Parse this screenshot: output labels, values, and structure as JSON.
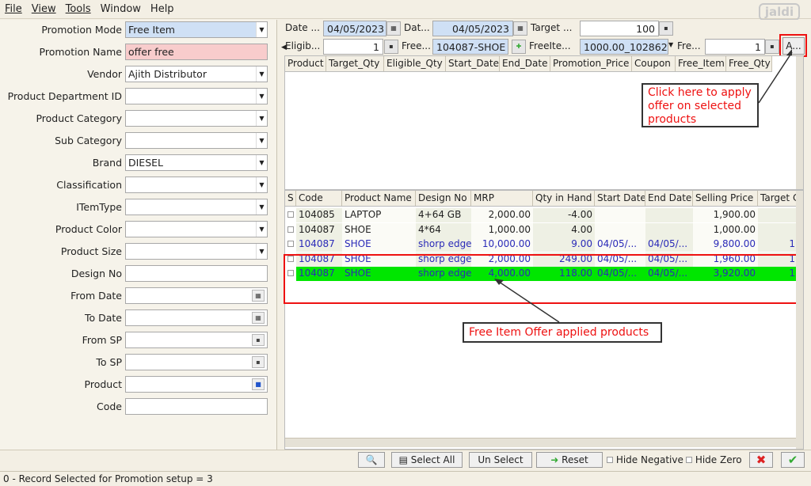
{
  "menu": [
    "File",
    "View",
    "Tools",
    "Window",
    "Help"
  ],
  "logo": "jaldi",
  "left_form": [
    {
      "label": "Promotion Mode",
      "value": "Free Item",
      "kind": "dropdown",
      "style": "blue"
    },
    {
      "label": "Promotion Name",
      "value": "offer free",
      "kind": "text",
      "style": "pink"
    },
    {
      "label": "Vendor",
      "value": "Ajith Distributor",
      "kind": "dropdown",
      "style": ""
    },
    {
      "label": "Product Department ID",
      "value": "",
      "kind": "dropdown",
      "style": ""
    },
    {
      "label": "Product Category",
      "value": "",
      "kind": "dropdown",
      "style": ""
    },
    {
      "label": "Sub Category",
      "value": "",
      "kind": "dropdown",
      "style": ""
    },
    {
      "label": "Brand",
      "value": "DIESEL",
      "kind": "dropdown",
      "style": ""
    },
    {
      "label": "Classification",
      "value": "",
      "kind": "dropdown",
      "style": ""
    },
    {
      "label": "ITemType",
      "value": "",
      "kind": "dropdown",
      "style": ""
    },
    {
      "label": "Product Color",
      "value": "",
      "kind": "dropdown",
      "style": ""
    },
    {
      "label": "Product Size",
      "value": "",
      "kind": "dropdown",
      "style": ""
    },
    {
      "label": "Design No",
      "value": "",
      "kind": "text",
      "style": ""
    },
    {
      "label": "From Date",
      "value": "",
      "kind": "date",
      "style": ""
    },
    {
      "label": "To Date",
      "value": "",
      "kind": "date",
      "style": ""
    },
    {
      "label": "From SP",
      "value": "",
      "kind": "num",
      "style": ""
    },
    {
      "label": "To SP",
      "value": "",
      "kind": "num",
      "style": ""
    },
    {
      "label": "Product",
      "value": "",
      "kind": "lookup",
      "style": ""
    },
    {
      "label": "Code",
      "value": "",
      "kind": "text",
      "style": ""
    }
  ],
  "top_form": {
    "date_from_label": "Date ...",
    "date_from_value": "04/05/2023",
    "date_to_label": "Dat...",
    "date_to_value": "04/05/2023",
    "target_label": "Target ...",
    "target_value": "100",
    "eligible_label": "Eligib...",
    "eligible_value": "1",
    "free_label": "Free...",
    "free_value": "104087-SHOE",
    "free_item_label": "FreeIte...",
    "free_item_value": "1000.00_102862",
    "free_qty_label": "Fre...",
    "free_qty_value": "1",
    "apply_label": "A..."
  },
  "promo_grid_columns": [
    "Product",
    "Target_Qty",
    "Eligible_Qty",
    "Start_Date",
    "End_Date",
    "Promotion_Price",
    "Coupon",
    "Free_Item",
    "Free_Qty"
  ],
  "product_grid_columns": [
    "S",
    "Code",
    "Product Name",
    "Design No",
    "MRP",
    "Qty in Hand",
    "Start Date",
    "End Date",
    "Selling Price",
    "Target C"
  ],
  "product_rows": [
    {
      "code": "104085",
      "name": "LAPTOP",
      "design": "4+64 GB",
      "mrp": "2,000.00",
      "qty": "-4.00",
      "start": "",
      "end": "",
      "sp": "1,900.00",
      "target": "",
      "state": "normal"
    },
    {
      "code": "104087",
      "name": "SHOE",
      "design": "4*64",
      "mrp": "1,000.00",
      "qty": "4.00",
      "start": "",
      "end": "",
      "sp": "1,000.00",
      "target": "",
      "state": "normal"
    },
    {
      "code": "104087",
      "name": "SHOE",
      "design": "shorp edge",
      "mrp": "10,000.00",
      "qty": "9.00",
      "start": "04/05/...",
      "end": "04/05/...",
      "sp": "9,800.00",
      "target": "1",
      "state": "applied"
    },
    {
      "code": "104087",
      "name": "SHOE",
      "design": "shorp edge",
      "mrp": "2,000.00",
      "qty": "249.00",
      "start": "04/05/...",
      "end": "04/05/...",
      "sp": "1,960.00",
      "target": "1",
      "state": "applied"
    },
    {
      "code": "104087",
      "name": "SHOE",
      "design": "shorp edge",
      "mrp": "4,000.00",
      "qty": "118.00",
      "start": "04/05/...",
      "end": "04/05/...",
      "sp": "3,920.00",
      "target": "1",
      "state": "selected"
    }
  ],
  "bottom": {
    "select_all": "Select All",
    "un_select": "Un Select",
    "reset": "Reset",
    "hide_negative": "Hide Negative",
    "hide_zero": "Hide Zero"
  },
  "status": "0 - Record Selected for Promotion setup = 3",
  "callouts": {
    "apply": "Click here to apply offer on selected products",
    "applied": "Free Item Offer applied products"
  },
  "colors": {
    "applied_text": "#2a2ab8",
    "selected_row": "#00e600",
    "highlight": "#e11111"
  }
}
